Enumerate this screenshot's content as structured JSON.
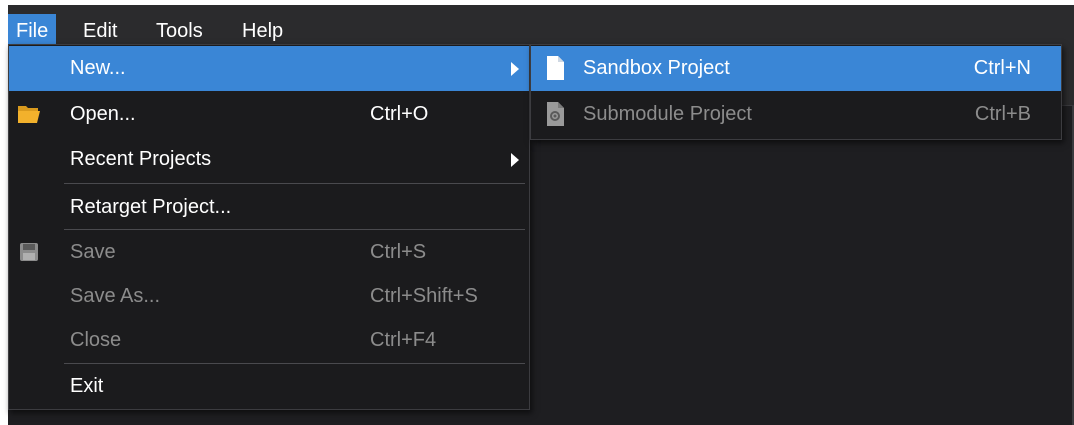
{
  "menubar": {
    "items": [
      {
        "label": "File",
        "active": true
      },
      {
        "label": "Edit",
        "active": false
      },
      {
        "label": "Tools",
        "active": false
      },
      {
        "label": "Help",
        "active": false
      }
    ]
  },
  "file_menu": {
    "items": [
      {
        "label": "New...",
        "shortcut": "",
        "submenu": true,
        "highlighted": true,
        "disabled": false,
        "icon": ""
      },
      {
        "label": "Open...",
        "shortcut": "Ctrl+O",
        "submenu": false,
        "highlighted": false,
        "disabled": false,
        "icon": "folder-open-icon"
      },
      {
        "label": "Recent Projects",
        "shortcut": "",
        "submenu": true,
        "highlighted": false,
        "disabled": false,
        "icon": ""
      },
      {
        "label": "Retarget Project...",
        "shortcut": "",
        "submenu": false,
        "highlighted": false,
        "disabled": false,
        "icon": ""
      },
      {
        "label": "Save",
        "shortcut": "Ctrl+S",
        "submenu": false,
        "highlighted": false,
        "disabled": true,
        "icon": "save-icon"
      },
      {
        "label": "Save As...",
        "shortcut": "Ctrl+Shift+S",
        "submenu": false,
        "highlighted": false,
        "disabled": true,
        "icon": ""
      },
      {
        "label": "Close",
        "shortcut": "Ctrl+F4",
        "submenu": false,
        "highlighted": false,
        "disabled": true,
        "icon": ""
      },
      {
        "label": "Exit",
        "shortcut": "",
        "submenu": false,
        "highlighted": false,
        "disabled": false,
        "icon": ""
      }
    ]
  },
  "new_submenu": {
    "items": [
      {
        "label": "Sandbox Project",
        "shortcut": "Ctrl+N",
        "highlighted": true,
        "disabled": false,
        "icon": "document-icon"
      },
      {
        "label": "Submodule Project",
        "shortcut": "Ctrl+B",
        "highlighted": false,
        "disabled": true,
        "icon": "module-document-icon"
      }
    ]
  },
  "colors": {
    "highlight": "#3a86d6",
    "menu_bg": "#1b1b1d",
    "menubar_bg": "#2b2b2d",
    "text": "#ffffff",
    "text_disabled": "#8c8c8c",
    "folder": "#f2b12c"
  }
}
